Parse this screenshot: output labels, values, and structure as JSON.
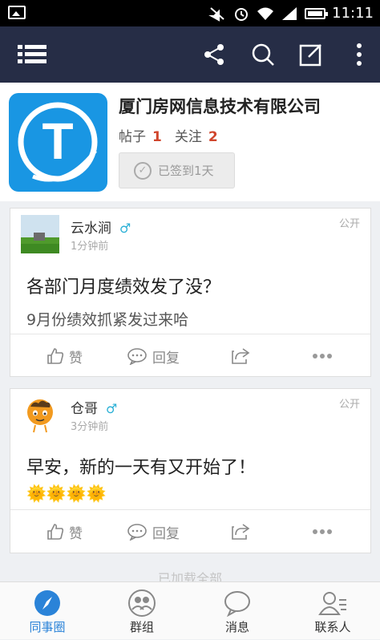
{
  "status_bar": {
    "time": "11:11"
  },
  "app_bar": {
    "icons": [
      "menu-icon",
      "share-icon",
      "search-icon",
      "compose-icon",
      "more-vertical-icon"
    ]
  },
  "group": {
    "name": "厦门房网信息技术有限公司",
    "posts_label": "帖子",
    "posts_count": "1",
    "follow_label": "关注",
    "follow_count": "2",
    "checkin_label": "已签到1天",
    "logo_letter": "T"
  },
  "posts": [
    {
      "author": "云水涧",
      "gender": "♂",
      "time": "1分钟前",
      "visibility": "公开",
      "title": "各部门月度绩效发了没？",
      "body": "9月份绩效抓紧发过来哈",
      "like_label": "赞",
      "reply_label": "回复"
    },
    {
      "author": "仓哥",
      "gender": "♂",
      "time": "3分钟前",
      "visibility": "公开",
      "title": "早安，新的一天有又开始了！",
      "emoji": "🌞🌞🌞🌞",
      "like_label": "赞",
      "reply_label": "回复"
    }
  ],
  "load_more": "已加载全部",
  "bottom_nav": [
    {
      "label": "同事圈",
      "active": true
    },
    {
      "label": "群组",
      "active": false
    },
    {
      "label": "消息",
      "active": false
    },
    {
      "label": "联系人",
      "active": false
    }
  ],
  "colors": {
    "appbar": "#262d46",
    "accent": "#2a83d8",
    "count": "#d0452c",
    "logo": "#1996e3"
  }
}
